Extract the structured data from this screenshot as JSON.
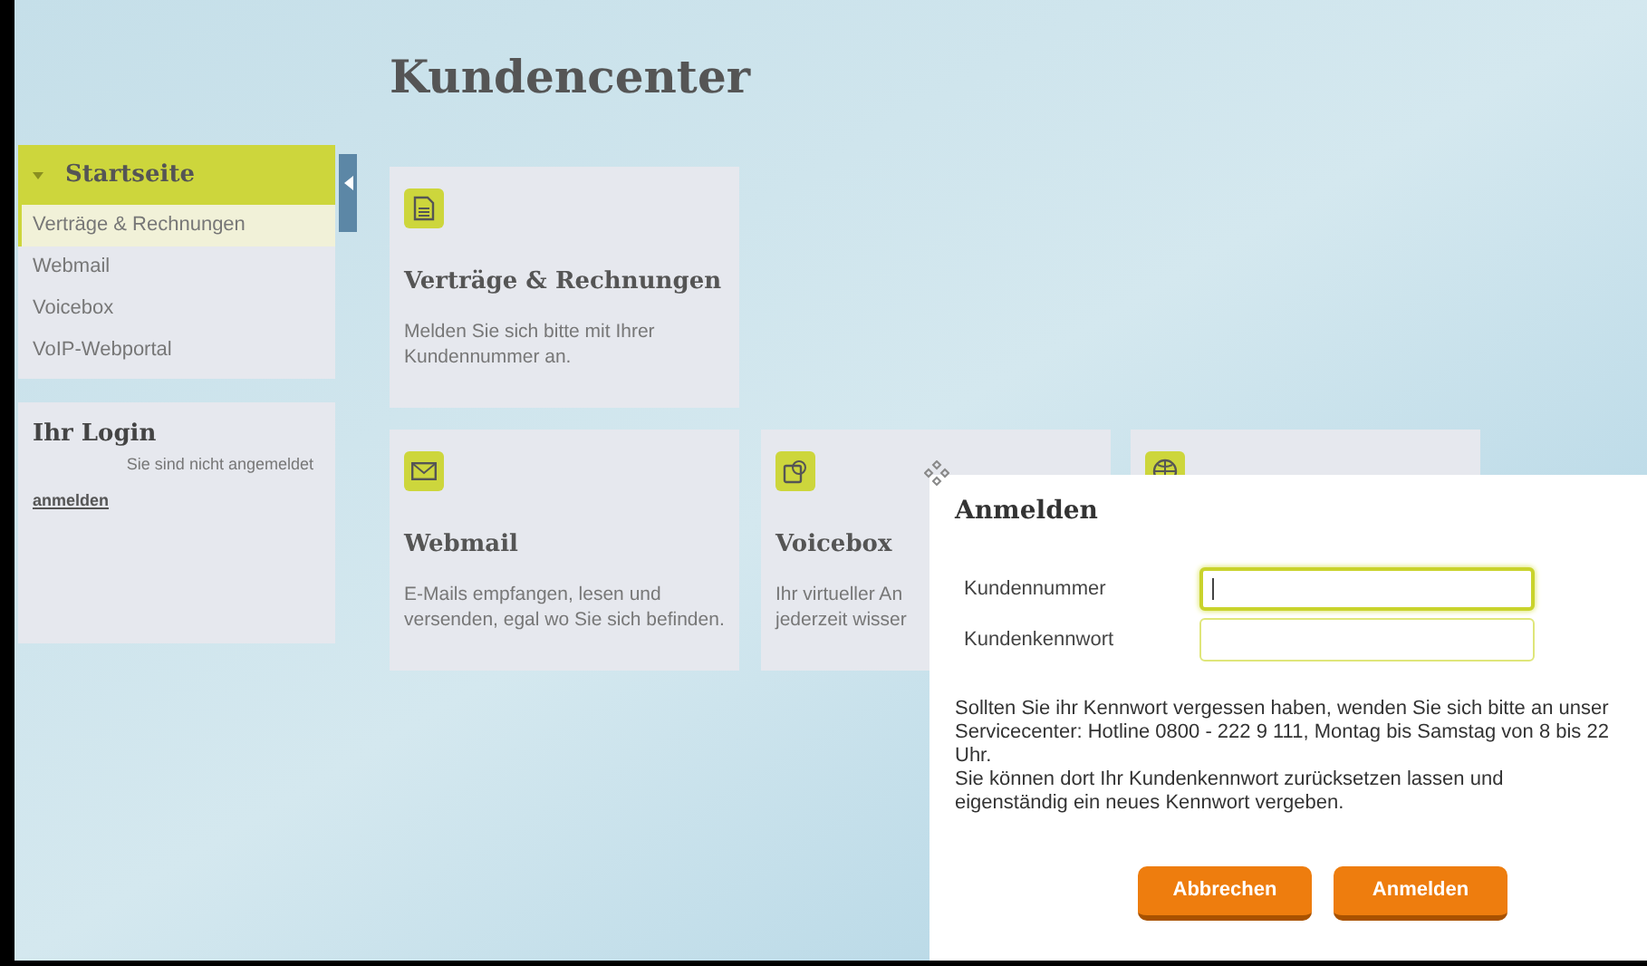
{
  "page_title": "Kundencenter",
  "sidebar": {
    "header": {
      "label": "Startseite",
      "expanded": true
    },
    "items": [
      {
        "label": "Verträge & Rechnungen",
        "selected": true
      },
      {
        "label": "Webmail",
        "selected": false
      },
      {
        "label": "Voicebox",
        "selected": false
      },
      {
        "label": "VoIP-Webportal",
        "selected": false
      }
    ]
  },
  "login_panel": {
    "title": "Ihr Login",
    "status": "Sie sind nicht angemeldet",
    "link": "anmelden"
  },
  "cards": [
    {
      "kind": "document",
      "title": "Verträge & Rechnungen",
      "lines": [
        "Melden Sie sich bitte mit Ihrer Kundennummer an."
      ]
    },
    {
      "kind": "mail",
      "title": "Webmail",
      "lines": [
        "E-Mails empfangen, lesen und versenden, egal wo Sie sich befinden."
      ]
    },
    {
      "kind": "voicebox",
      "title": "Voicebox",
      "lines": [
        "Ihr virtueller An",
        "jederzeit wisser"
      ]
    },
    {
      "kind": "globe"
    }
  ],
  "dialog": {
    "title": "Anmelden",
    "fields": [
      {
        "label": "Kundennummer",
        "focused": true
      },
      {
        "label": "Kundenkennwort",
        "focused": false
      }
    ],
    "info": [
      "Sollten Sie ihr Kennwort vergessen haben, wenden Sie sich bitte an unser Servicecenter: Hotline 0800 - 222 9 111, Montag bis Samstag von 8 bis 22 Uhr.",
      "Sie können dort Ihr Kundenkennwort zurücksetzen lassen und eigenständig ein neues Kennwort vergeben."
    ],
    "buttons": [
      "Abbrechen",
      "Anmelden"
    ]
  }
}
